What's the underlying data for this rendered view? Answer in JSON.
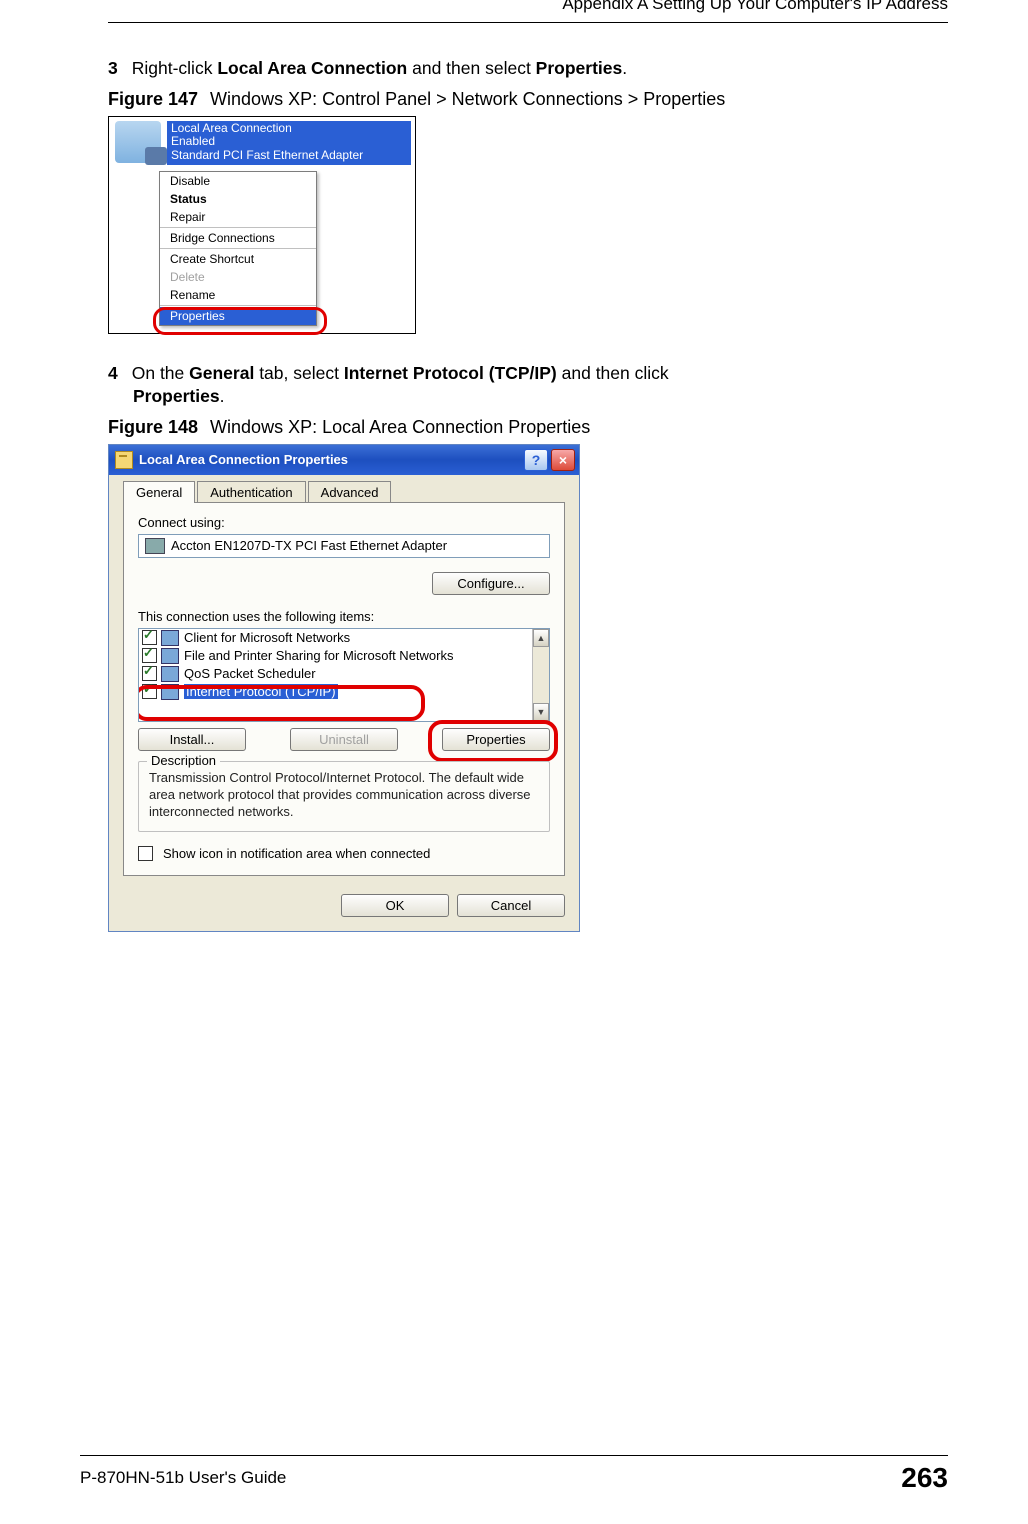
{
  "header": {
    "appendix_title": "Appendix A Setting Up Your Computer's IP Address"
  },
  "step3": {
    "num": "3",
    "t1": "Right-click ",
    "b1": "Local Area Connection",
    "t2": " and then select ",
    "b2": "Properties",
    "t3": "."
  },
  "fig147": {
    "label": "Figure 147",
    "caption": "Windows XP: Control Panel > Network Connections > Properties",
    "lac_title": "Local Area Connection",
    "lac_status": "Enabled",
    "lac_adapter": "Standard PCI Fast Ethernet Adapter",
    "menu": {
      "disable": "Disable",
      "status": "Status",
      "repair": "Repair",
      "bridge": "Bridge Connections",
      "shortcut": "Create Shortcut",
      "delete": "Delete",
      "rename": "Rename",
      "properties": "Properties"
    }
  },
  "step4": {
    "num": "4",
    "t1": "On the ",
    "b1": "General",
    "t2": " tab, select ",
    "b2": "Internet Protocol (TCP/IP)",
    "t3": " and then click ",
    "b3": "Properties",
    "t4": "."
  },
  "fig148": {
    "label": "Figure 148",
    "caption": "Windows XP: Local Area Connection Properties",
    "dialog": {
      "title": "Local Area Connection Properties",
      "tabs": {
        "general": "General",
        "auth": "Authentication",
        "adv": "Advanced"
      },
      "connect_using": "Connect using:",
      "device": "Accton EN1207D-TX PCI Fast Ethernet Adapter",
      "configure": "Configure...",
      "items_label": "This connection uses the following items:",
      "items": {
        "client": "Client for Microsoft Networks",
        "fps": "File and Printer Sharing for Microsoft Networks",
        "qos": "QoS Packet Scheduler",
        "tcpip": "Internet Protocol (TCP/IP)"
      },
      "install": "Install...",
      "uninstall": "Uninstall",
      "properties": "Properties",
      "desc_group": "Description",
      "desc_text": "Transmission Control Protocol/Internet Protocol. The default wide area network protocol that provides communication across diverse interconnected networks.",
      "notify": "Show icon in notification area when connected",
      "ok": "OK",
      "cancel": "Cancel"
    }
  },
  "footer": {
    "guide": "P-870HN-51b User's Guide",
    "page": "263"
  }
}
